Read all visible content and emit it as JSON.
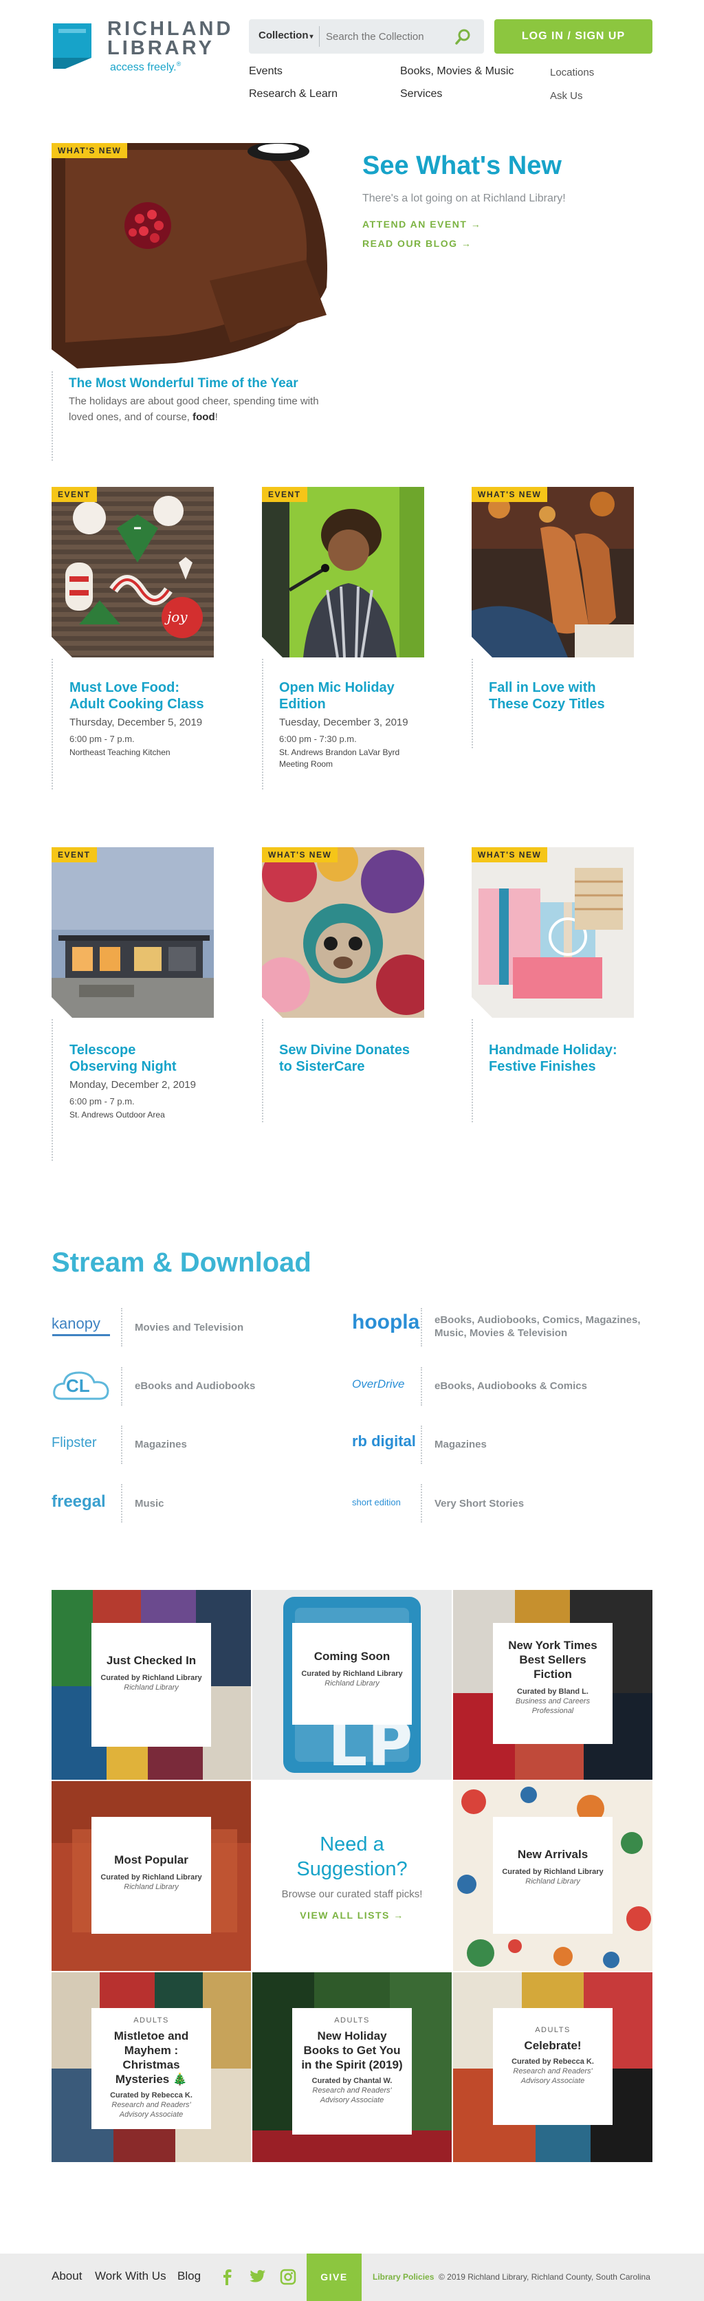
{
  "header": {
    "logo_line1": "RICHLAND",
    "logo_line2": "LIBRARY",
    "logo_tagline": "access freely.",
    "logo_reg": "®",
    "search": {
      "scope": "Collection",
      "placeholder": "Search the Collection"
    },
    "login_label": "LOG IN / SIGN UP",
    "nav": {
      "events": "Events",
      "research": "Research & Learn",
      "books": "Books, Movies & Music",
      "services": "Services",
      "locations": "Locations",
      "ask_us": "Ask Us"
    }
  },
  "hero": {
    "tag": "WHAT'S NEW",
    "heading": "See What's New",
    "subheading": "There's a lot going on at Richland Library!",
    "link1": "ATTEND AN EVENT →",
    "link2": "READ OUR BLOG →",
    "feature_title": "The Most Wonderful Time of the Year",
    "feature_text_pre": "The holidays are about good cheer, spending time with loved ones, and of course, ",
    "feature_text_bold": "food",
    "feature_text_post": "!"
  },
  "cards": [
    {
      "tag": "EVENT",
      "title": "Must Love Food: Adult Cooking Class",
      "date": "Thursday, December 5, 2019",
      "time": "6:00 pm - 7 p.m.",
      "location": "Northeast Teaching Kitchen"
    },
    {
      "tag": "EVENT",
      "title": "Open Mic Holiday Edition",
      "date": "Tuesday, December 3, 2019",
      "time": "6:00 pm - 7:30 p.m.",
      "location": "St. Andrews Brandon LaVar Byrd Meeting Room"
    },
    {
      "tag": "WHAT'S NEW",
      "title": "Fall in Love with These Cozy Titles",
      "date": "",
      "time": "",
      "location": ""
    },
    {
      "tag": "EVENT",
      "title": "Telescope Observing Night",
      "date": "Monday, December 2, 2019",
      "time": "6:00 pm - 7 p.m.",
      "location": "St. Andrews Outdoor Area"
    },
    {
      "tag": "WHAT'S NEW",
      "title": "Sew Divine Donates to SisterCare",
      "date": "",
      "time": "",
      "location": ""
    },
    {
      "tag": "WHAT'S NEW",
      "title": "Handmade Holiday: Festive Finishes",
      "date": "",
      "time": "",
      "location": ""
    }
  ],
  "stream": {
    "heading": "Stream & Download",
    "services": [
      {
        "logo": "kanopy",
        "desc": "Movies and Television"
      },
      {
        "logo": "hoopla",
        "desc": "eBooks, Audiobooks, Comics, Magazines, Music, Movies & Television"
      },
      {
        "logo": "CL",
        "desc": "eBooks and Audiobooks"
      },
      {
        "logo": "OverDrive",
        "desc": "eBooks, Audiobooks & Comics"
      },
      {
        "logo": "Flipster",
        "desc": "Magazines"
      },
      {
        "logo": "rb digital",
        "desc": "Magazines"
      },
      {
        "logo": "freegal",
        "desc": "Music"
      },
      {
        "logo": "short edition",
        "desc": "Very Short Stories"
      }
    ]
  },
  "lists": {
    "tiles": [
      {
        "kicker": "",
        "title": "Just Checked In",
        "curated": "Curated by Richland Library",
        "org": "Richland Library"
      },
      {
        "kicker": "",
        "title": "Coming Soon",
        "curated": "Curated by Richland Library",
        "org": "Richland Library"
      },
      {
        "kicker": "",
        "title": "New York Times Best Sellers Fiction",
        "curated": "Curated by Bland L.",
        "org": "Business and Careers Professional"
      },
      {
        "kicker": "",
        "title": "Most Popular",
        "curated": "Curated by Richland Library",
        "org": "Richland Library"
      },
      {
        "kicker": "",
        "title": "New Arrivals",
        "curated": "Curated by Richland Library",
        "org": "Richland Library"
      },
      {
        "kicker": "ADULTS",
        "title": "Mistletoe and Mayhem : Christmas Mysteries 🎄",
        "curated": "Curated by Rebecca K.",
        "org": "Research and Readers' Advisory Associate"
      },
      {
        "kicker": "ADULTS",
        "title": "New Holiday Books to Get You in the Spirit (2019)",
        "curated": "Curated by Chantal W.",
        "org": "Research and Readers' Advisory Associate"
      },
      {
        "kicker": "ADULTS",
        "title": "Celebrate!",
        "curated": "Curated by Rebecca K.",
        "org": "Research and Readers' Advisory Associate"
      }
    ],
    "suggestion": {
      "heading": "Need a Suggestion?",
      "sub": "Browse our curated staff picks!",
      "link": "VIEW ALL LISTS →"
    }
  },
  "footer": {
    "about": "About",
    "work": "Work With Us",
    "blog": "Blog",
    "give": "GIVE",
    "policies": "Library Policies",
    "copyright": "© 2019 Richland Library, Richland County, South Carolina"
  },
  "colors": {
    "brand_blue": "#17a3c9",
    "brand_green": "#8cc63f",
    "tag_yellow": "#f5c518"
  }
}
